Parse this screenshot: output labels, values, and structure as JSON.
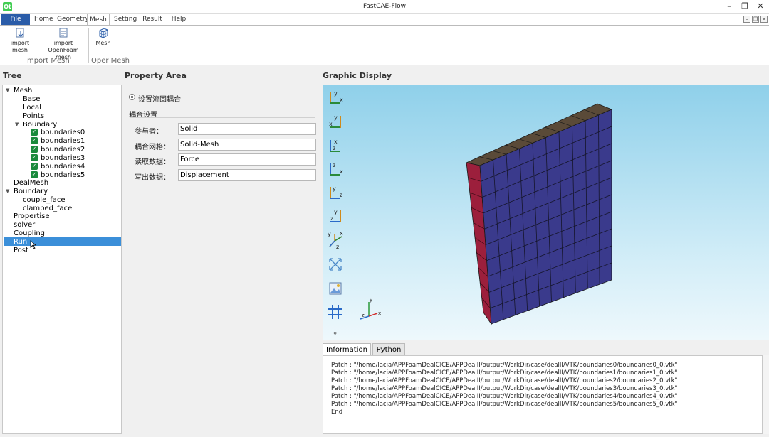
{
  "window": {
    "title": "FastCAE-Flow",
    "icon_label": "Qt"
  },
  "menu": {
    "file": "File",
    "tabs": [
      "Home",
      "Geometry",
      "Mesh",
      "Setting",
      "Result",
      "Help"
    ],
    "active_tab": "Mesh"
  },
  "ribbon": {
    "import_mesh": "import mesh",
    "import_openfoam_line1": "import OpenFoam",
    "import_openfoam_line2": "mesh",
    "mesh": "Mesh",
    "group_import": "Import Mesh",
    "group_oper": "Oper Mesh"
  },
  "panels": {
    "tree": "Tree",
    "property": "Property Area",
    "graphic": "Graphic Display"
  },
  "tree": {
    "mesh": "Mesh",
    "base": "Base",
    "local": "Local",
    "points": "Points",
    "boundary": "Boundary",
    "boundaries": [
      "boundaries0",
      "boundaries1",
      "boundaries2",
      "boundaries3",
      "boundaries4",
      "boundaries5"
    ],
    "dealmesh": "DealMesh",
    "boundary2": "Boundary",
    "couple_face": "couple_face",
    "clamped_face": "clamped_face",
    "propertise": "Propertise",
    "solver": "solver",
    "coupling": "Coupling",
    "run": "Run",
    "post": "Post",
    "selected": "Run"
  },
  "property": {
    "radio_label": "设置流固耦合",
    "group_label": "耦合设置",
    "fields": [
      {
        "label": "参与者：",
        "value": "Solid"
      },
      {
        "label": "耦合网格：",
        "value": "Solid-Mesh"
      },
      {
        "label": "读取数据：",
        "value": "Force"
      },
      {
        "label": "写出数据：",
        "value": "Displacement"
      }
    ]
  },
  "graphic": {
    "axis_labels": {
      "x": "x",
      "y": "y",
      "z": "z"
    },
    "more": "»"
  },
  "info": {
    "tabs": [
      "Information",
      "Python"
    ],
    "active_tab": "Information",
    "log": [
      "Patch    : \"/home/lacia/APPFoamDealCICE/APPDealII/output/WorkDir/case/dealII/VTK/boundaries0/boundaries0_0.vtk\"",
      "Patch    : \"/home/lacia/APPFoamDealCICE/APPDealII/output/WorkDir/case/dealII/VTK/boundaries1/boundaries1_0.vtk\"",
      "Patch    : \"/home/lacia/APPFoamDealCICE/APPDealII/output/WorkDir/case/dealII/VTK/boundaries2/boundaries2_0.vtk\"",
      "Patch    : \"/home/lacia/APPFoamDealCICE/APPDealII/output/WorkDir/case/dealII/VTK/boundaries3/boundaries3_0.vtk\"",
      "Patch    : \"/home/lacia/APPFoamDealCICE/APPDealII/output/WorkDir/case/dealII/VTK/boundaries4/boundaries4_0.vtk\"",
      "Patch    : \"/home/lacia/APPFoamDealCICE/APPDealII/output/WorkDir/case/dealII/VTK/boundaries5/boundaries5_0.vtk\"",
      "End"
    ]
  },
  "colors": {
    "file_button": "#2a5ca8",
    "selection": "#3b8fd9",
    "checkbox": "#1a8a3c",
    "mesh_front": "#3a3a8c",
    "mesh_side": "#9c1f3c",
    "mesh_top": "#5a4a3a"
  }
}
